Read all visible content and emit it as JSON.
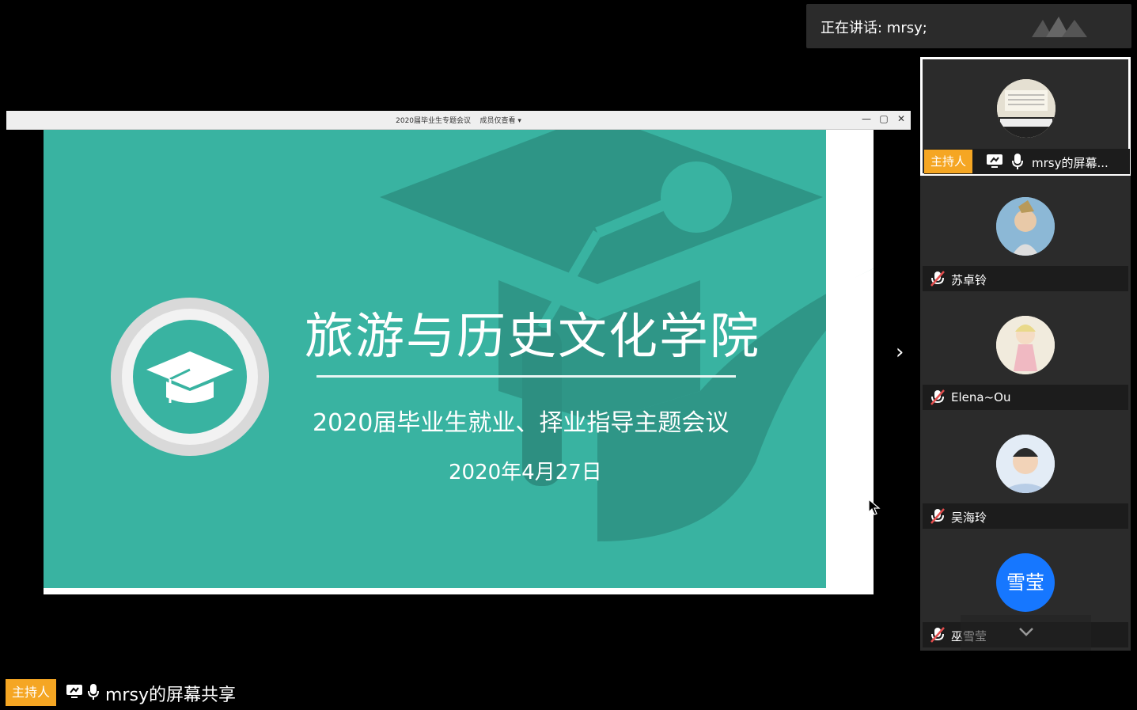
{
  "speaking": {
    "label": "正在讲话: mrsy;"
  },
  "share_window": {
    "title": "2020届毕业生专题会议",
    "view_mode": "成员仅查看 ▾",
    "controls": [
      "—",
      "▢",
      "✕"
    ]
  },
  "slide": {
    "title": "旅游与历史文化学院",
    "subtitle": "2020届毕业生就业、择业指导主题会议",
    "date": "2020年4月27日",
    "colors": {
      "green": "#39b3a1",
      "dark_green": "#2d8f81"
    }
  },
  "participants": [
    {
      "name": "mrsy的屏幕...",
      "badge": "主持人",
      "active": true,
      "muted": false,
      "avatar": "piano-photo"
    },
    {
      "name": "苏卓铃",
      "muted": true,
      "avatar": "portrait-photo"
    },
    {
      "name": "Elena~Ou",
      "muted": true,
      "avatar": "illustration"
    },
    {
      "name": "吴海玲",
      "muted": true,
      "avatar": "child-photo"
    },
    {
      "name": "巫雪莹",
      "muted": true,
      "avatar_text": "雪莹",
      "avatar_color": "#1677ff"
    }
  ],
  "bottom_bar": {
    "badge": "主持人",
    "label": "mrsy的屏幕共享"
  },
  "colors": {
    "host_badge": "#f5a623",
    "tile_bg": "#2b2b2b"
  }
}
